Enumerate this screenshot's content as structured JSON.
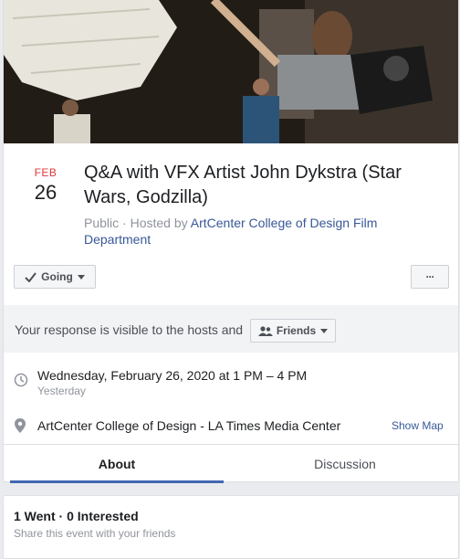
{
  "event": {
    "month": "FEB",
    "day": "26",
    "title": "Q&A with VFX Artist John Dykstra (Star Wars, Godzilla)",
    "privacy": "Public",
    "hosted_by_prefix": "· Hosted by",
    "host": "ArtCenter College of Design Film Department"
  },
  "actions": {
    "going_label": "Going",
    "more_label": "···"
  },
  "notice": {
    "text": "Your response is visible to the hosts and",
    "audience": "Friends"
  },
  "details": {
    "datetime": "Wednesday, February 26, 2020 at 1 PM – 4 PM",
    "relative": "Yesterday",
    "location": "ArtCenter College of Design - LA Times Media Center",
    "map_link": "Show Map"
  },
  "tabs": [
    "About",
    "Discussion"
  ],
  "attendance": {
    "summary": "1 Went · 0 Interested",
    "share": "Share this event with your friends"
  }
}
